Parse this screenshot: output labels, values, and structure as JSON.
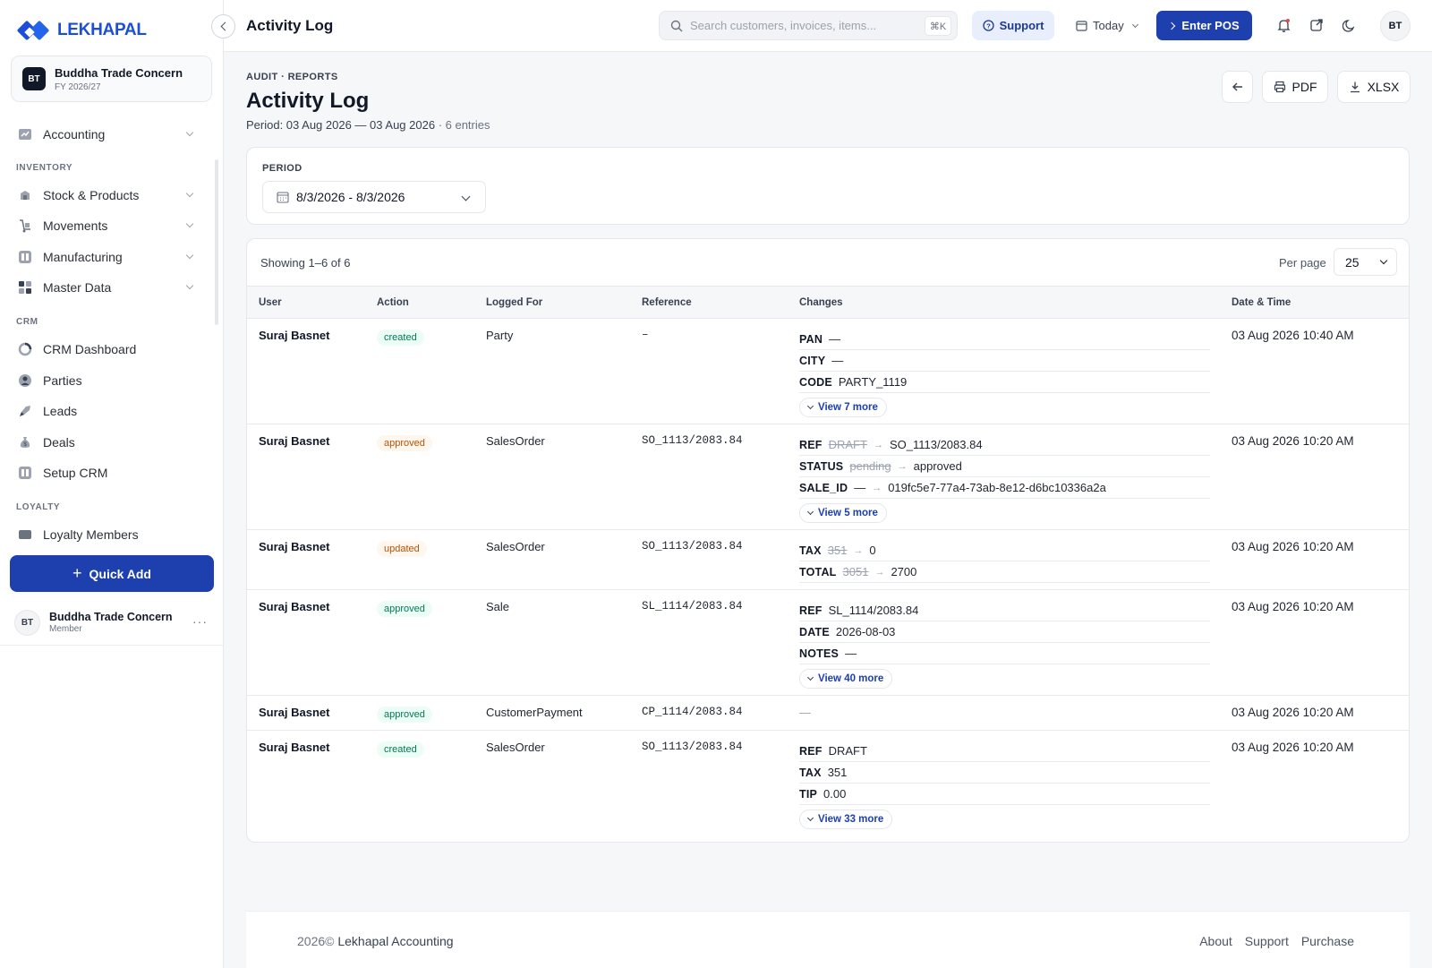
{
  "app": {
    "logo_text": "LEKHAPAL",
    "accent": "#1e40af"
  },
  "company": {
    "initials": "BT",
    "name": "Buddha Trade Concern",
    "fy": "FY 2026/27"
  },
  "sidebar": {
    "items": [
      {
        "label": "Accounting",
        "icon": "accounting-icon"
      },
      {
        "label": "Stock & Products",
        "icon": "box-icon"
      },
      {
        "label": "Movements",
        "icon": "dolly-icon"
      },
      {
        "label": "Manufacturing",
        "icon": "factory-icon"
      },
      {
        "label": "Master Data",
        "icon": "grid-icon"
      },
      {
        "label": "CRM Dashboard",
        "icon": "chart-icon"
      },
      {
        "label": "Parties",
        "icon": "user-icon"
      },
      {
        "label": "Leads",
        "icon": "rocket-icon"
      },
      {
        "label": "Deals",
        "icon": "money-bag-icon"
      },
      {
        "label": "Setup CRM",
        "icon": "settings-icon"
      },
      {
        "label": "Loyalty Members",
        "icon": "card-icon"
      }
    ],
    "sections": {
      "inventory": "INVENTORY",
      "crm": "CRM",
      "loyalty": "LOYALTY"
    },
    "quick_add": "Quick Add",
    "user": {
      "initials": "BT",
      "name": "Buddha Trade Concern",
      "role": "Member",
      "more": "···"
    }
  },
  "topbar": {
    "title": "Activity Log",
    "search_placeholder": "Search customers, invoices, items...",
    "shortcut": "⌘K",
    "support": "Support",
    "today": "Today",
    "enter_pos": "Enter POS",
    "avatar": "BT"
  },
  "header": {
    "breadcrumb": "AUDIT · REPORTS",
    "title": "Activity Log",
    "period_prefix": "Period: 03 Aug 2026 — 03 Aug 2026",
    "entries": "· 6 entries",
    "pdf": "PDF",
    "xlsx": "XLSX"
  },
  "filter": {
    "label": "PERIOD",
    "value": "8/3/2026 - 8/3/2026"
  },
  "table": {
    "showing": "Showing 1–6 of 6",
    "per_page_label": "Per page",
    "per_page": "25",
    "columns": [
      "User",
      "Action",
      "Logged For",
      "Reference",
      "Changes",
      "Date & Time"
    ],
    "rows": [
      {
        "user": "Suraj Basnet",
        "action": "created",
        "logged_for": "Party",
        "reference": "–",
        "date": "03 Aug 2026 10:40 AM",
        "changes": [
          {
            "key": "PAN",
            "new": "—"
          },
          {
            "key": "CITY",
            "new": "—"
          },
          {
            "key": "CODE",
            "new": "PARTY_1119"
          }
        ],
        "more": "View 7 more"
      },
      {
        "user": "Suraj Basnet",
        "action": "approved",
        "logged_for": "SalesOrder",
        "reference": "SO_1113/2083.84",
        "date": "03 Aug 2026 10:20 AM",
        "changes": [
          {
            "key": "REF",
            "old": "DRAFT",
            "new": "SO_1113/2083.84"
          },
          {
            "key": "STATUS",
            "old": "pending",
            "new": "approved"
          },
          {
            "key": "SALE_ID",
            "old": "—",
            "new": "019fc5e7-77a4-73ab-8e12-d6bc10336a2a"
          }
        ],
        "more": "View 5 more"
      },
      {
        "user": "Suraj Basnet",
        "action": "updated",
        "logged_for": "SalesOrder",
        "reference": "SO_1113/2083.84",
        "date": "03 Aug 2026 10:20 AM",
        "changes": [
          {
            "key": "TAX",
            "old": "351",
            "new": "0"
          },
          {
            "key": "TOTAL",
            "old": "3051",
            "new": "2700"
          }
        ]
      },
      {
        "user": "Suraj Basnet",
        "action": "approved",
        "logged_for": "Sale",
        "reference": "SL_1114/2083.84",
        "date": "03 Aug 2026 10:20 AM",
        "changes": [
          {
            "key": "REF",
            "new": "SL_1114/2083.84"
          },
          {
            "key": "DATE",
            "new": "2026-08-03"
          },
          {
            "key": "NOTES",
            "new": "—"
          }
        ],
        "more": "View 40 more"
      },
      {
        "user": "Suraj Basnet",
        "action": "approved",
        "logged_for": "CustomerPayment",
        "reference": "CP_1114/2083.84",
        "date": "03 Aug 2026 10:20 AM",
        "changes_text": "—"
      },
      {
        "user": "Suraj Basnet",
        "action": "created",
        "logged_for": "SalesOrder",
        "reference": "SO_1113/2083.84",
        "date": "03 Aug 2026 10:20 AM",
        "changes": [
          {
            "key": "REF",
            "new": "DRAFT"
          },
          {
            "key": "TAX",
            "new": "351"
          },
          {
            "key": "TIP",
            "new": "0.00"
          }
        ],
        "more": "View 33 more"
      }
    ]
  },
  "footer": {
    "year": "2026©",
    "brand": "Lekhapal Accounting",
    "links": [
      "About",
      "Support",
      "Purchase"
    ]
  }
}
